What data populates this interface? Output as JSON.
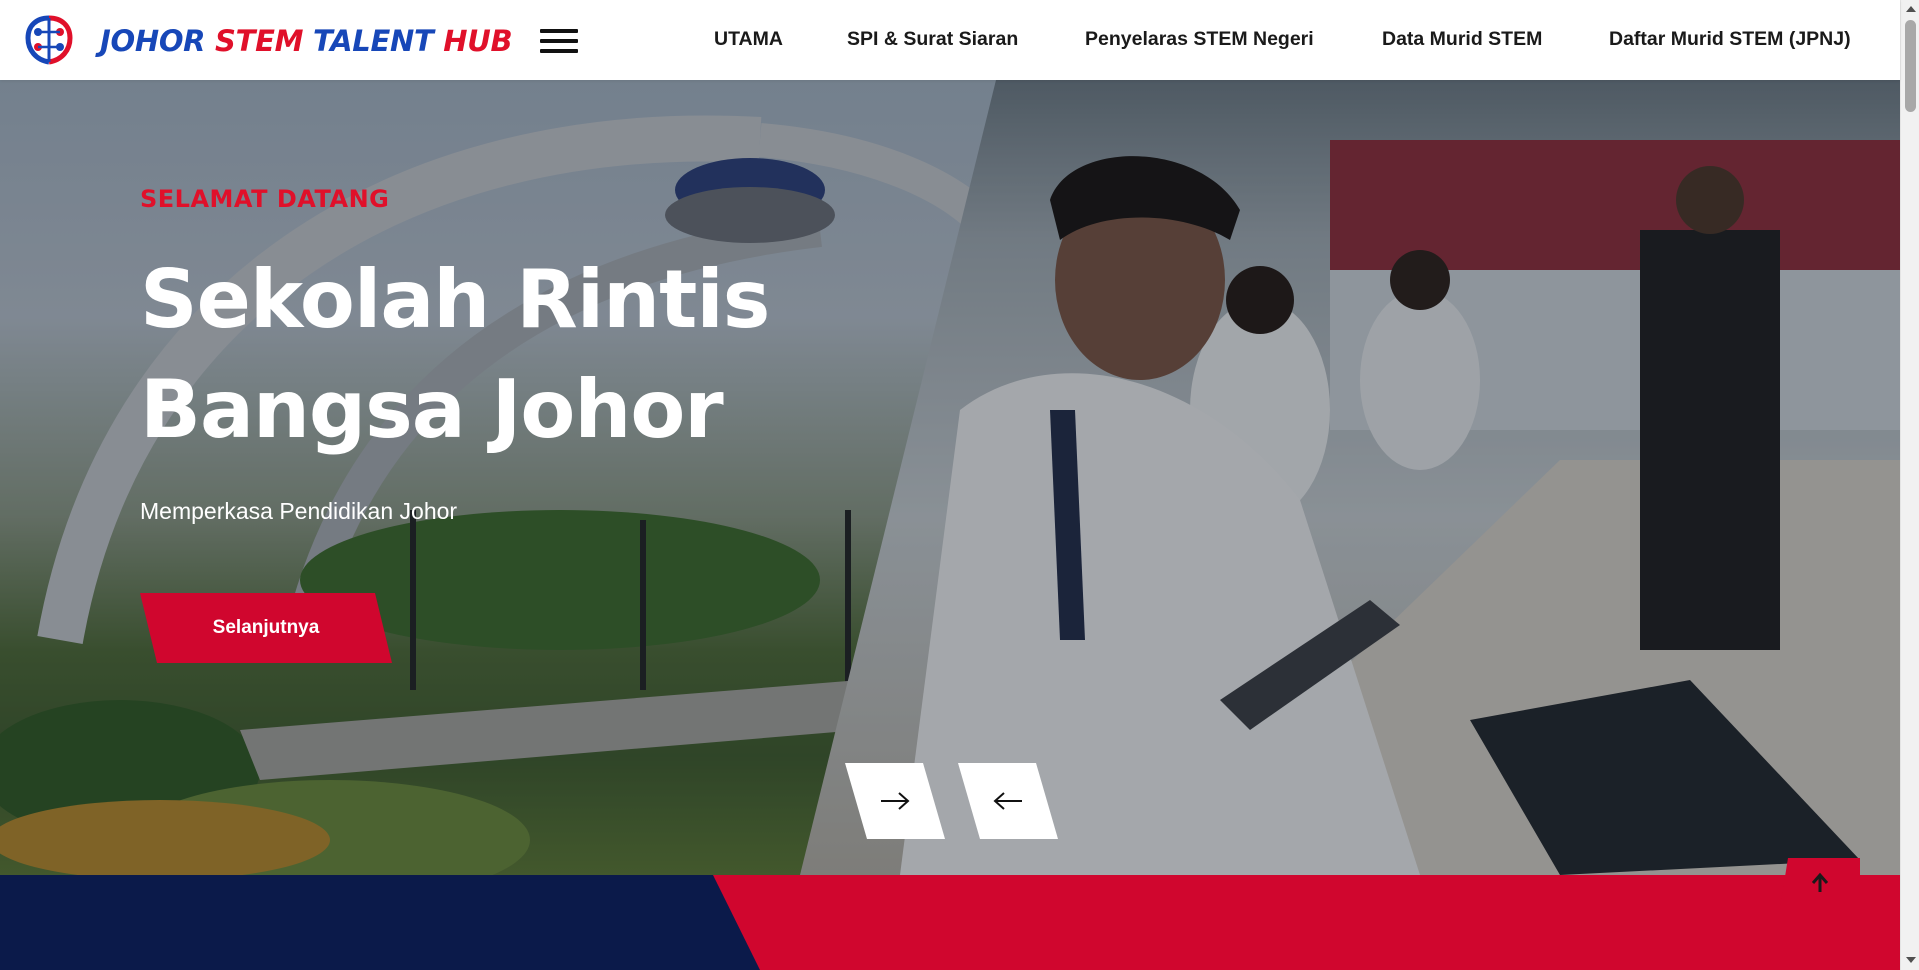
{
  "header": {
    "logo_icon": "brain-circuit-logo",
    "logo_text_parts": [
      "JOHOR ",
      "STEM ",
      "TALENT ",
      "HUB"
    ],
    "menu_icon": "hamburger-menu-icon",
    "nav": [
      "UTAMA",
      "SPI & Surat Siaran",
      "Penyelaras STEM Negeri",
      "Data Murid STEM",
      "Daftar Murid STEM (JPNJ)"
    ]
  },
  "hero": {
    "eyebrow": "SELAMAT DATANG",
    "headline": "Sekolah Rintis Bangsa Johor",
    "subtitle": "Memperkasa Pendidikan Johor",
    "cta_label": "Selanjutnya",
    "next_icon": "arrow-right-icon",
    "prev_icon": "arrow-left-icon"
  },
  "back_to_top_icon": "arrow-up-icon",
  "colors": {
    "brand_blue": "#1747b8",
    "brand_red": "#d0062e",
    "navy": "#0b1a4a"
  }
}
